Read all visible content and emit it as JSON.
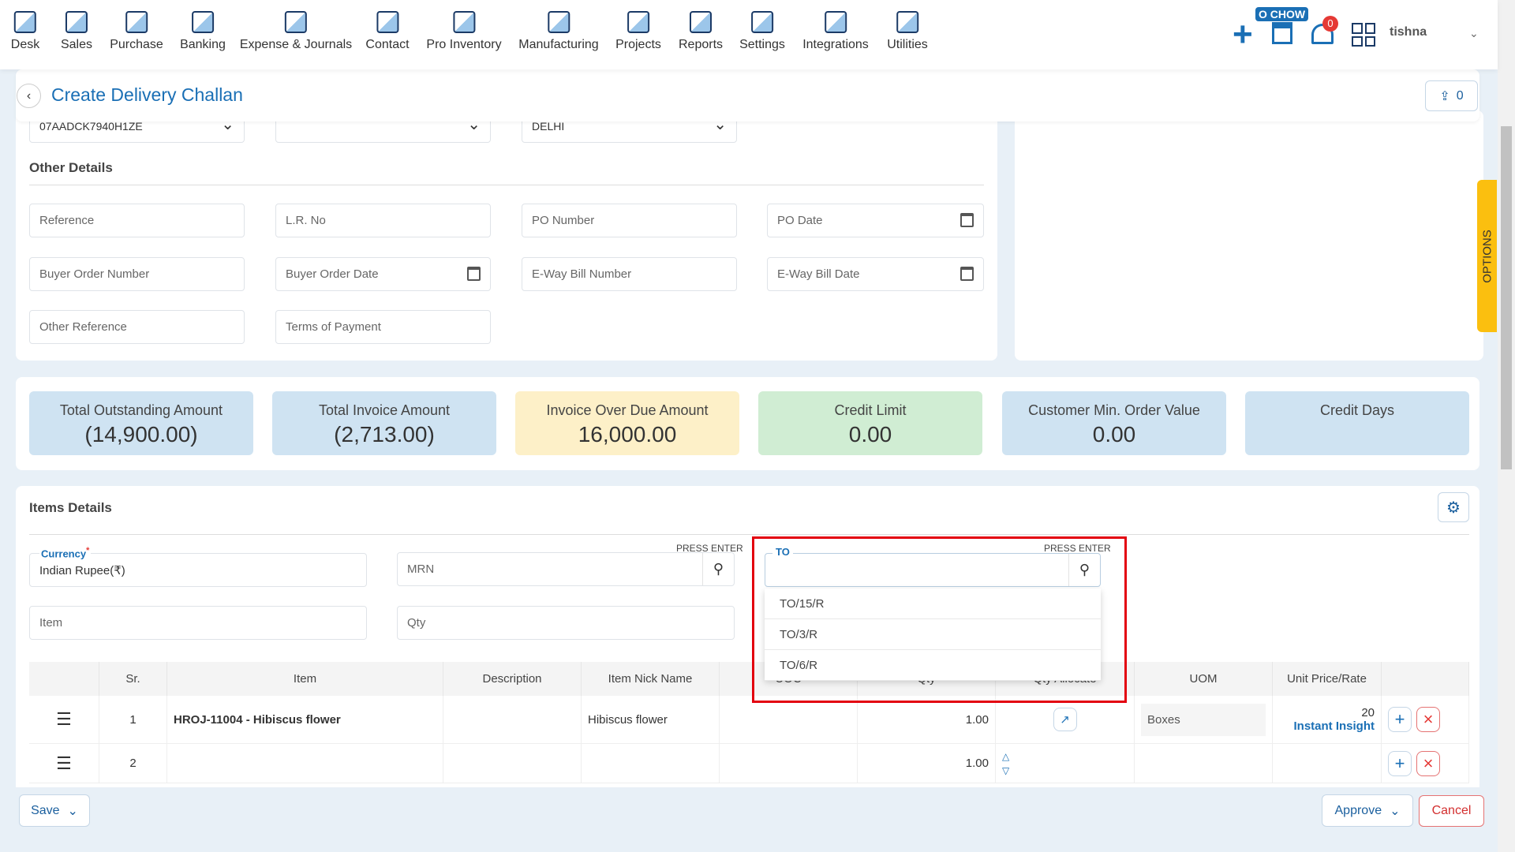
{
  "nav": {
    "items": [
      {
        "label": "Desk",
        "icon": "desk-icon"
      },
      {
        "label": "Sales",
        "icon": "sales-icon"
      },
      {
        "label": "Purchase",
        "icon": "cart-icon"
      },
      {
        "label": "Banking",
        "icon": "bank-icon"
      },
      {
        "label": "Expense & Journals",
        "icon": "journal-icon"
      },
      {
        "label": "Contact",
        "icon": "contact-icon"
      },
      {
        "label": "Pro Inventory",
        "icon": "inventory-icon"
      },
      {
        "label": "Manufacturing",
        "icon": "factory-icon"
      },
      {
        "label": "Projects",
        "icon": "projects-icon"
      },
      {
        "label": "Reports",
        "icon": "reports-icon"
      },
      {
        "label": "Settings",
        "icon": "sliders-icon"
      },
      {
        "label": "Integrations",
        "icon": "integrations-icon"
      },
      {
        "label": "Utilities",
        "icon": "utilities-icon"
      }
    ],
    "company_badge": "O CHOW",
    "notification_count": "0",
    "user": "tishna"
  },
  "header": {
    "title": "Create Delivery Challan",
    "upload_count": "0"
  },
  "top_selects": [
    "07AADCK7940H1ZE",
    "",
    "DELHI"
  ],
  "other_details": {
    "title": "Other Details",
    "fields": [
      "Reference",
      "L.R. No",
      "PO Number",
      "PO Date",
      "Buyer Order Number",
      "Buyer Order Date",
      "E-Way Bill Number",
      "E-Way Bill Date",
      "Other Reference",
      "Terms of Payment"
    ]
  },
  "options_tab": "OPTIONS",
  "summary": [
    {
      "label": "Total Outstanding Amount",
      "value": "(14,900.00)",
      "color": "#cfe3f2"
    },
    {
      "label": "Total Invoice Amount",
      "value": "(2,713.00)",
      "color": "#cfe3f2"
    },
    {
      "label": "Invoice Over Due Amount",
      "value": "16,000.00",
      "color": "#fdf0c8"
    },
    {
      "label": "Credit Limit",
      "value": "0.00",
      "color": "#d0edd3"
    },
    {
      "label": "Customer Min. Order Value",
      "value": "0.00",
      "color": "#cfe3f2"
    },
    {
      "label": "Credit Days",
      "value": "",
      "color": "#cfe3f2"
    }
  ],
  "items": {
    "title": "Items Details",
    "currency_label": "Currency",
    "currency_value": "Indian Rupee(₹)",
    "mrn_placeholder": "MRN",
    "press_enter": "PRESS ENTER",
    "to_label": "TO",
    "to_value": "",
    "item_placeholder": "Item",
    "qty_placeholder": "Qty",
    "to_options": [
      "TO/15/R",
      "TO/3/R",
      "TO/6/R"
    ],
    "columns": [
      "",
      "Sr.",
      "Item",
      "Description",
      "Item Nick Name",
      "UOC",
      "Qty",
      "Qty Allocate",
      "UOM",
      "Unit Price/Rate",
      ""
    ],
    "rows": [
      {
        "sr": "1",
        "item": "HROJ-11004 - Hibiscus flower",
        "nick": "Hibiscus flower",
        "qty": "1.00",
        "uom": "Boxes",
        "rate": "20",
        "insight": "Instant Insight"
      },
      {
        "sr": "2",
        "item": "",
        "nick": "",
        "qty": "1.00",
        "uom": "",
        "rate": "",
        "insight": ""
      }
    ]
  },
  "footer": {
    "save": "Save",
    "approve": "Approve",
    "cancel": "Cancel"
  },
  "colors": {
    "accent": "#1a6fb5",
    "highlight": "#e3000f",
    "options": "#fbbf0f"
  }
}
